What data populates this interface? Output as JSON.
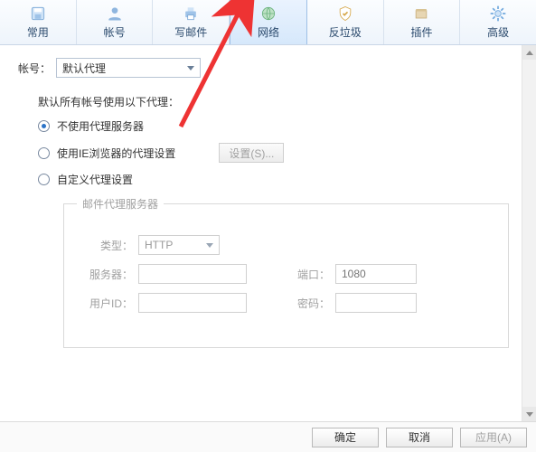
{
  "tabs": {
    "common": "常用",
    "account": "帐号",
    "compose": "写邮件",
    "network": "网络",
    "antispam": "反垃圾",
    "plugins": "插件",
    "advanced": "高级"
  },
  "account_label": "帐号：",
  "account_value": "默认代理",
  "desc": "默认所有帐号使用以下代理：",
  "radios": {
    "none": "不使用代理服务器",
    "ie": "使用IE浏览器的代理设置",
    "custom": "自定义代理设置"
  },
  "settings_btn": "设置(S)...",
  "fieldset": {
    "legend": "邮件代理服务器",
    "labels": {
      "type": "类型：",
      "server": "服务器：",
      "user": "用户ID：",
      "port": "端口：",
      "password": "密码："
    },
    "type_value": "HTTP",
    "server_value": "",
    "user_value": "",
    "port_placeholder": "1080",
    "password_value": ""
  },
  "footer": {
    "ok": "确定",
    "cancel": "取消",
    "apply": "应用(A)"
  }
}
